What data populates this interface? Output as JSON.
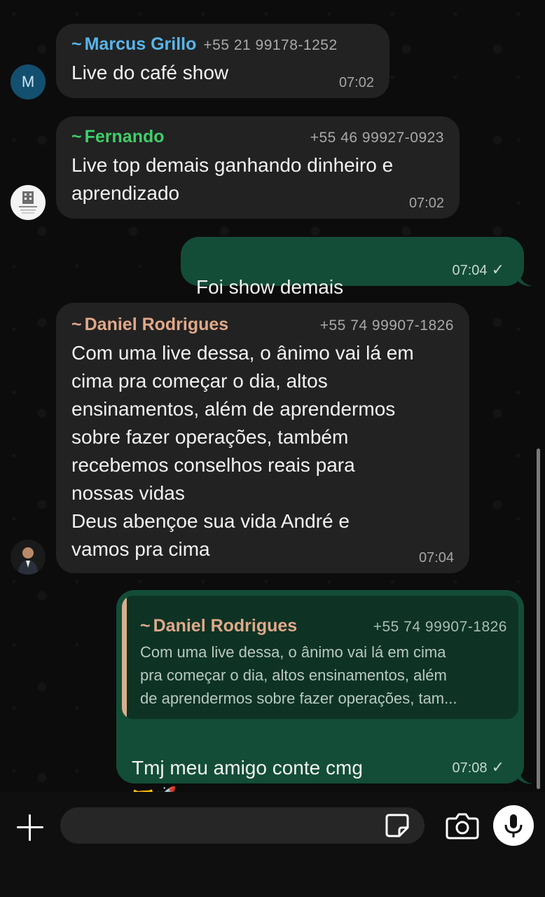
{
  "colors": {
    "incoming_bubble": "#222222",
    "outgoing_bubble": "#134d37",
    "marcus_name": "#59b5ea",
    "fernando_name": "#3fcf6a",
    "daniel_name": "#e0a98a"
  },
  "messages": [
    {
      "sender": "Marcus Grillo",
      "tilde": "~",
      "phone": "+55 21 99178-1252",
      "avatar_letter": "M",
      "text": "Live do café show",
      "time": "07:02"
    },
    {
      "sender": "Fernando",
      "tilde": "~",
      "phone": "+55 46 99927-0923",
      "text": "Live top demais ganhando dinheiro e\naprendizado",
      "time": "07:02"
    },
    {
      "text": "Foi show demais",
      "emoji": "👏🏼👏🏼",
      "time": "07:04",
      "status": "✓"
    },
    {
      "sender": "Daniel Rodrigues",
      "tilde": "~",
      "phone": "+55 74 99907-1826",
      "text": "Com uma live dessa, o ânimo vai lá em\ncima pra começar o dia, altos\nensinamentos, além de aprendermos\nsobre fazer operações, também\nrecebemos conselhos reais para\nnossas vidas\nDeus abençoe sua vida André e\nvamos pra cima",
      "time": "07:04"
    },
    {
      "quote": {
        "tilde": "~",
        "sender": "Daniel Rodrigues",
        "phone": "+55 74 99907-1826",
        "text": "Com uma live dessa, o ânimo vai lá em cima\npra começar o dia, altos ensinamentos, além\nde aprendermos sobre fazer operações, tam..."
      },
      "text": "Tmj meu amigo conte cmg",
      "emoji": "🤝🚀",
      "time": "07:08",
      "status": "✓"
    }
  ],
  "composer": {
    "placeholder": "",
    "icons": [
      "plus-icon",
      "sticker-icon",
      "camera-icon",
      "microphone-icon"
    ]
  }
}
